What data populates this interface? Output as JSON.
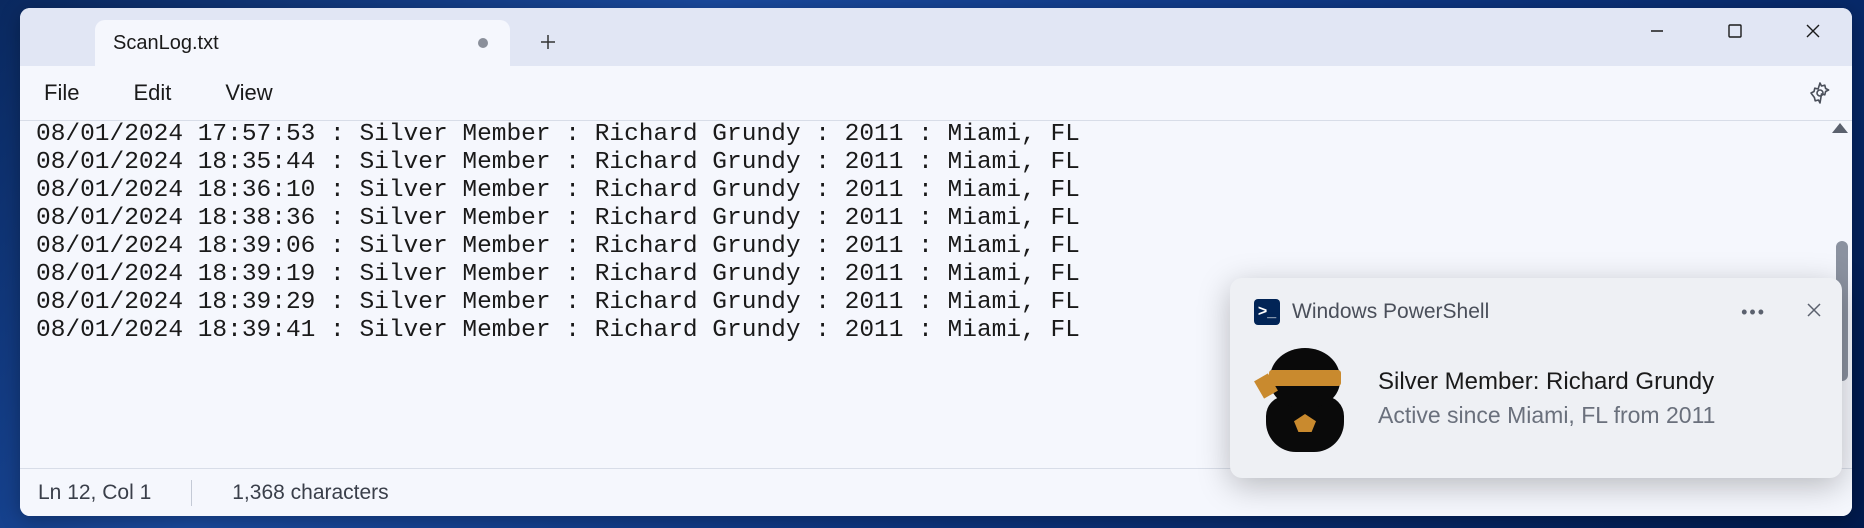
{
  "tab": {
    "title": "ScanLog.txt",
    "modified": true
  },
  "menu": {
    "file": "File",
    "edit": "Edit",
    "view": "View"
  },
  "log_lines": [
    "08/01/2024 17:57:53 : Silver Member : Richard Grundy : 2011 : Miami, FL",
    "08/01/2024 18:35:44 : Silver Member : Richard Grundy : 2011 : Miami, FL",
    "08/01/2024 18:36:10 : Silver Member : Richard Grundy : 2011 : Miami, FL",
    "08/01/2024 18:38:36 : Silver Member : Richard Grundy : 2011 : Miami, FL",
    "08/01/2024 18:39:06 : Silver Member : Richard Grundy : 2011 : Miami, FL",
    "08/01/2024 18:39:19 : Silver Member : Richard Grundy : 2011 : Miami, FL",
    "08/01/2024 18:39:29 : Silver Member : Richard Grundy : 2011 : Miami, FL",
    "08/01/2024 18:39:41 : Silver Member : Richard Grundy : 2011 : Miami, FL"
  ],
  "status": {
    "position": "Ln 12, Col 1",
    "chars": "1,368 characters"
  },
  "toast": {
    "app": "Windows PowerShell",
    "title": "Silver Member: Richard Grundy",
    "subtitle": "Active since Miami, FL from 2011"
  }
}
